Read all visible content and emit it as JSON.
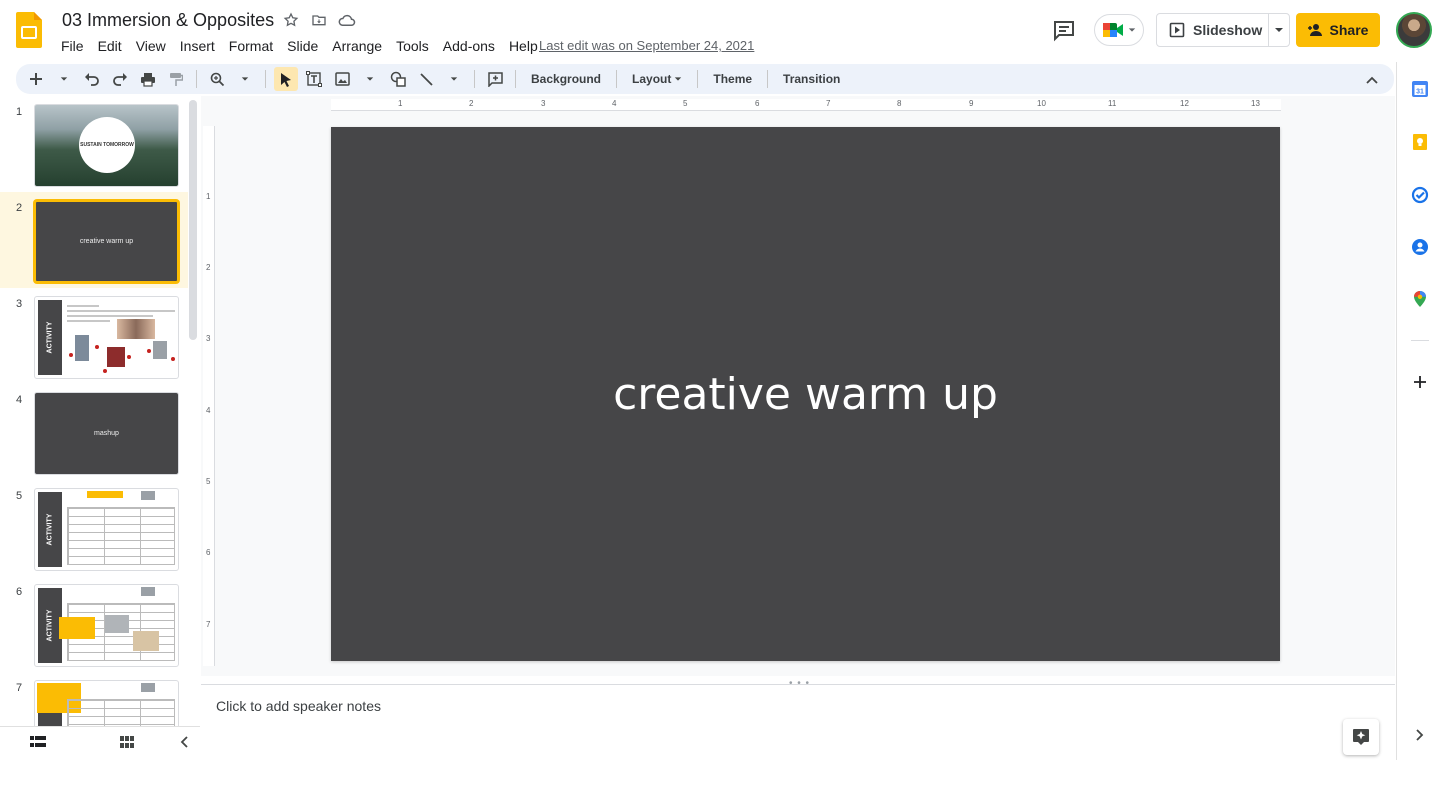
{
  "header": {
    "title": "03 Immersion & Opposites",
    "last_edit": "Last edit was on September 24, 2021",
    "menu": [
      "File",
      "Edit",
      "View",
      "Insert",
      "Format",
      "Slide",
      "Arrange",
      "Tools",
      "Add-ons",
      "Help"
    ],
    "slideshow_label": "Slideshow",
    "share_label": "Share"
  },
  "toolbar": {
    "background_label": "Background",
    "layout_label": "Layout",
    "theme_label": "Theme",
    "transition_label": "Transition"
  },
  "filmstrip": {
    "slides": [
      {
        "num": "1",
        "text": "SUSTAIN TOMORROW"
      },
      {
        "num": "2",
        "text": "creative warm up"
      },
      {
        "num": "3",
        "text": "ACTIVITY"
      },
      {
        "num": "4",
        "text": "mashup"
      },
      {
        "num": "5",
        "text": "ACTIVITY"
      },
      {
        "num": "6",
        "text": "ACTIVITY"
      },
      {
        "num": "7",
        "text": ""
      }
    ]
  },
  "ruler": {
    "h": [
      "1",
      "2",
      "3",
      "4",
      "5",
      "6",
      "7",
      "8",
      "9",
      "10",
      "11",
      "12",
      "13"
    ],
    "v": [
      "1",
      "2",
      "3",
      "4",
      "5",
      "6",
      "7"
    ]
  },
  "slide": {
    "title": "creative warm up"
  },
  "notes": {
    "placeholder": "Click to add speaker notes"
  },
  "colors": {
    "accent": "#fbbc04",
    "slide_bg": "#464648"
  }
}
